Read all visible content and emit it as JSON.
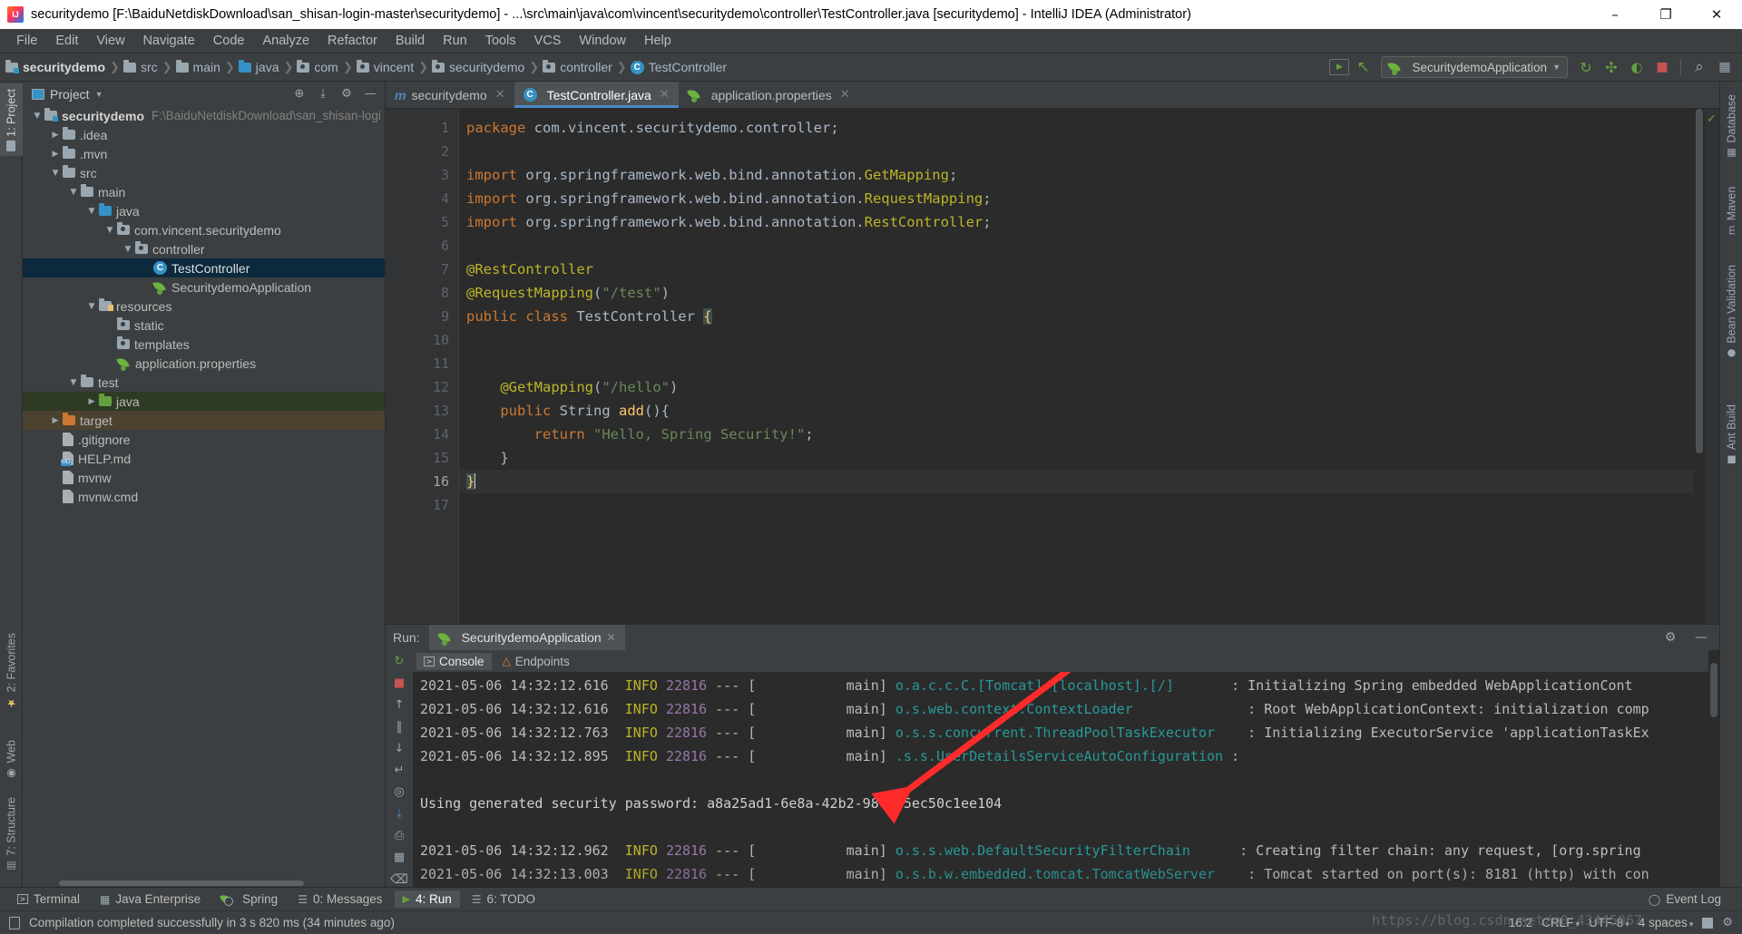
{
  "window": {
    "title": "securitydemo [F:\\BaiduNetdiskDownload\\san_shisan-login-master\\securitydemo] - ...\\src\\main\\java\\com\\vincent\\securitydemo\\controller\\TestController.java [securitydemo] - IntelliJ IDEA (Administrator)",
    "minimize": "–",
    "maximize": "❐",
    "close": "✕"
  },
  "menu": [
    "File",
    "Edit",
    "View",
    "Navigate",
    "Code",
    "Analyze",
    "Refactor",
    "Build",
    "Run",
    "Tools",
    "VCS",
    "Window",
    "Help"
  ],
  "breadcrumb": [
    {
      "label": "securitydemo",
      "icon": "module-icon",
      "bold": true
    },
    {
      "label": "src",
      "icon": "folder-icon",
      "bold": false
    },
    {
      "label": "main",
      "icon": "folder-icon",
      "bold": false
    },
    {
      "label": "java",
      "icon": "source-folder-icon",
      "bold": false
    },
    {
      "label": "com",
      "icon": "package-icon",
      "bold": false
    },
    {
      "label": "vincent",
      "icon": "package-icon",
      "bold": false
    },
    {
      "label": "securitydemo",
      "icon": "package-icon",
      "bold": false
    },
    {
      "label": "controller",
      "icon": "package-icon",
      "bold": false
    },
    {
      "label": "TestController",
      "icon": "class-icon",
      "bold": false
    }
  ],
  "toolbar": {
    "run_config": "SecuritydemoApplication",
    "dropdown_caret": "▼",
    "buttons": [
      {
        "name": "select-run-config-icon",
        "glyph": "▶"
      },
      {
        "name": "hammer-build-icon",
        "glyph": "↖"
      },
      {
        "name": "rerun-icon",
        "glyph": "↻"
      },
      {
        "name": "debug-icon",
        "glyph": "✣"
      },
      {
        "name": "run-with-coverage-icon",
        "glyph": "◐"
      },
      {
        "name": "stop-icon",
        "glyph": "■"
      },
      {
        "name": "search-everywhere-icon",
        "glyph": "⌕"
      },
      {
        "name": "project-structure-icon",
        "glyph": "▦"
      }
    ]
  },
  "left_strip": [
    {
      "label": "1: Project",
      "active": true
    },
    {
      "label": "2: Favorites",
      "active": false
    },
    {
      "label": "Web",
      "active": false
    },
    {
      "label": "7: Structure",
      "active": false
    }
  ],
  "right_strip": [
    {
      "label": "Database"
    },
    {
      "label": "Maven"
    },
    {
      "label": "Bean Validation"
    },
    {
      "label": "Ant Build"
    }
  ],
  "project_panel": {
    "title": "Project",
    "title_caret": "▼",
    "header_buttons": [
      {
        "name": "locate-in-tree-icon",
        "glyph": "⊕"
      },
      {
        "name": "collapse-all-icon",
        "glyph": "⤓"
      },
      {
        "name": "settings-gear-icon",
        "glyph": "⚙"
      },
      {
        "name": "hide-panel-icon",
        "glyph": "—"
      }
    ],
    "tree": [
      {
        "label": "securitydemo",
        "suffix": "F:\\BaiduNetdiskDownload\\san_shisan-logi",
        "indent": 0,
        "arrow": "▼",
        "icon": "module-icon",
        "bold": true,
        "state": ""
      },
      {
        "label": ".idea",
        "suffix": "",
        "indent": 1,
        "arrow": "▶",
        "icon": "folder-icon",
        "bold": false,
        "state": ""
      },
      {
        "label": ".mvn",
        "suffix": "",
        "indent": 1,
        "arrow": "▶",
        "icon": "folder-icon",
        "bold": false,
        "state": ""
      },
      {
        "label": "src",
        "suffix": "",
        "indent": 1,
        "arrow": "▼",
        "icon": "folder-icon",
        "bold": false,
        "state": ""
      },
      {
        "label": "main",
        "suffix": "",
        "indent": 2,
        "arrow": "▼",
        "icon": "folder-icon",
        "bold": false,
        "state": ""
      },
      {
        "label": "java",
        "suffix": "",
        "indent": 3,
        "arrow": "▼",
        "icon": "source-folder-icon",
        "bold": false,
        "state": ""
      },
      {
        "label": "com.vincent.securitydemo",
        "suffix": "",
        "indent": 4,
        "arrow": "▼",
        "icon": "package-icon",
        "bold": false,
        "state": ""
      },
      {
        "label": "controller",
        "suffix": "",
        "indent": 5,
        "arrow": "▼",
        "icon": "package-icon",
        "bold": false,
        "state": ""
      },
      {
        "label": "TestController",
        "suffix": "",
        "indent": 6,
        "arrow": "",
        "icon": "class-icon",
        "bold": false,
        "state": "selected"
      },
      {
        "label": "SecuritydemoApplication",
        "suffix": "",
        "indent": 6,
        "arrow": "",
        "icon": "spring-class-icon",
        "bold": false,
        "state": ""
      },
      {
        "label": "resources",
        "suffix": "",
        "indent": 3,
        "arrow": "▼",
        "icon": "resources-folder-icon",
        "bold": false,
        "state": ""
      },
      {
        "label": "static",
        "suffix": "",
        "indent": 4,
        "arrow": "",
        "icon": "package-icon",
        "bold": false,
        "state": ""
      },
      {
        "label": "templates",
        "suffix": "",
        "indent": 4,
        "arrow": "",
        "icon": "package-icon",
        "bold": false,
        "state": ""
      },
      {
        "label": "application.properties",
        "suffix": "",
        "indent": 4,
        "arrow": "",
        "icon": "spring-file-icon",
        "bold": false,
        "state": ""
      },
      {
        "label": "test",
        "suffix": "",
        "indent": 2,
        "arrow": "▼",
        "icon": "folder-icon",
        "bold": false,
        "state": ""
      },
      {
        "label": "java",
        "suffix": "",
        "indent": 3,
        "arrow": "▶",
        "icon": "test-source-folder-icon",
        "bold": false,
        "state": "green"
      },
      {
        "label": "target",
        "suffix": "",
        "indent": 1,
        "arrow": "▶",
        "icon": "excluded-folder-icon",
        "bold": false,
        "state": "brown"
      },
      {
        "label": ".gitignore",
        "suffix": "",
        "indent": 2,
        "arrow": "",
        "icon": "file-icon",
        "bold": false,
        "state": ""
      },
      {
        "label": "HELP.md",
        "suffix": "",
        "indent": 2,
        "arrow": "",
        "icon": "markdown-file-icon",
        "bold": false,
        "state": ""
      },
      {
        "label": "mvnw",
        "suffix": "",
        "indent": 2,
        "arrow": "",
        "icon": "file-icon",
        "bold": false,
        "state": ""
      },
      {
        "label": "mvnw.cmd",
        "suffix": "",
        "indent": 2,
        "arrow": "",
        "icon": "file-icon",
        "bold": false,
        "state": ""
      }
    ]
  },
  "editor": {
    "tabs": [
      {
        "label": "securitydemo",
        "icon": "maven-icon",
        "active": false,
        "close": "✕"
      },
      {
        "label": "TestController.java",
        "icon": "class-icon",
        "active": true,
        "close": "✕"
      },
      {
        "label": "application.properties",
        "icon": "spring-file-icon",
        "active": false,
        "close": "✕"
      }
    ],
    "inspection_status": "✓",
    "caret_position": "16:2",
    "lines": [
      {
        "n": 1,
        "text": "package com.vincent.securitydemo.controller;"
      },
      {
        "n": 2,
        "text": ""
      },
      {
        "n": 3,
        "text": "import org.springframework.web.bind.annotation.GetMapping;"
      },
      {
        "n": 4,
        "text": "import org.springframework.web.bind.annotation.RequestMapping;"
      },
      {
        "n": 5,
        "text": "import org.springframework.web.bind.annotation.RestController;"
      },
      {
        "n": 6,
        "text": ""
      },
      {
        "n": 7,
        "text": "@RestController"
      },
      {
        "n": 8,
        "text": "@RequestMapping(\"/test\")"
      },
      {
        "n": 9,
        "text": "public class TestController {"
      },
      {
        "n": 10,
        "text": ""
      },
      {
        "n": 11,
        "text": ""
      },
      {
        "n": 12,
        "text": "    @GetMapping(\"/hello\")"
      },
      {
        "n": 13,
        "text": "    public String add(){"
      },
      {
        "n": 14,
        "text": "        return \"Hello, Spring Security!\";"
      },
      {
        "n": 15,
        "text": "    }"
      },
      {
        "n": 16,
        "text": "}"
      },
      {
        "n": 17,
        "text": ""
      }
    ]
  },
  "run_panel": {
    "label": "Run:",
    "tab": "SecuritydemoApplication",
    "tab_close": "✕",
    "settings_icon": "⚙",
    "hide_icon": "—",
    "console_tabs": [
      {
        "label": "Console",
        "active": true,
        "icon": "console-icon"
      },
      {
        "label": "Endpoints",
        "active": false,
        "icon": "endpoints-icon"
      }
    ],
    "side_buttons": [
      {
        "name": "rerun-icon",
        "glyph": "↻"
      },
      {
        "name": "stop-icon",
        "glyph": "■"
      },
      {
        "name": "scroll-up-icon",
        "glyph": "↑"
      },
      {
        "name": "pause-icon",
        "glyph": "‖"
      },
      {
        "name": "scroll-down-icon",
        "glyph": "↓"
      },
      {
        "name": "soft-wrap-icon",
        "glyph": "↵"
      },
      {
        "name": "camera-icon",
        "glyph": "◎"
      },
      {
        "name": "scroll-to-end-icon",
        "glyph": "⤓"
      },
      {
        "name": "print-icon",
        "glyph": "⎙"
      },
      {
        "name": "dump-threads-icon",
        "glyph": "▦"
      },
      {
        "name": "clear-all-icon",
        "glyph": "Ὕ1"
      }
    ],
    "log_lines": [
      {
        "ts": "2021-05-06 14:32:12.616",
        "level": "INFO",
        "pid": "22816",
        "dash": "---",
        "thread": "main]",
        "logger": "o.a.c.c.C.[Tomcat].[localhost].[/]",
        "msg": ": Initializing Spring embedded WebApplicationCont",
        "type": "log"
      },
      {
        "ts": "2021-05-06 14:32:12.616",
        "level": "INFO",
        "pid": "22816",
        "dash": "---",
        "thread": "main]",
        "logger": "o.s.web.context.ContextLoader",
        "msg": ": Root WebApplicationContext: initialization comp",
        "type": "log"
      },
      {
        "ts": "2021-05-06 14:32:12.763",
        "level": "INFO",
        "pid": "22816",
        "dash": "---",
        "thread": "main]",
        "logger": "o.s.s.concurrent.ThreadPoolTaskExecutor",
        "msg": ": Initializing ExecutorService 'applicationTaskEx",
        "type": "log"
      },
      {
        "ts": "2021-05-06 14:32:12.895",
        "level": "INFO",
        "pid": "22816",
        "dash": "---",
        "thread": "main]",
        "logger": ".s.s.UserDetailsServiceAutoConfiguration",
        "msg": ":",
        "type": "log"
      },
      {
        "text": "",
        "type": "blank"
      },
      {
        "text": "Using generated security password: a8a25ad1-6e8a-42b2-98c3-5ec50c1ee104",
        "type": "plain"
      },
      {
        "text": "",
        "type": "blank"
      },
      {
        "ts": "2021-05-06 14:32:12.962",
        "level": "INFO",
        "pid": "22816",
        "dash": "---",
        "thread": "main]",
        "logger": "o.s.s.web.DefaultSecurityFilterChain",
        "msg": ": Creating filter chain: any request, [org.spring",
        "type": "log"
      },
      {
        "ts": "2021-05-06 14:32:13.003",
        "level": "INFO",
        "pid": "22816",
        "dash": "---",
        "thread": "main]",
        "logger": "o.s.b.w.embedded.tomcat.TomcatWebServer",
        "msg": ": Tomcat started on port(s): 8181 (http) with con",
        "type": "log"
      }
    ]
  },
  "bottom_tabs": [
    {
      "label": "Terminal",
      "active": false,
      "icon": "terminal-icon"
    },
    {
      "label": "Java Enterprise",
      "active": false,
      "icon": "java-enterprise-icon"
    },
    {
      "label": "Spring",
      "active": false,
      "icon": "spring-icon"
    },
    {
      "label": "0: Messages",
      "active": false,
      "icon": "messages-icon"
    },
    {
      "label": "4: Run",
      "active": true,
      "icon": "run-icon"
    },
    {
      "label": "6: TODO",
      "active": false,
      "icon": "todo-icon"
    }
  ],
  "event_log": "Event Log",
  "statusbar": {
    "message": "Compilation completed successfully in 3 s 820 ms (34 minutes ago)",
    "caret": "16:2",
    "line_separator": "CRLF",
    "encoding": "UTF-8",
    "indent": "4 spaces",
    "caret_glyph": "▾",
    "watermark": "https://blog.csdn.net/m0_43445067"
  },
  "colors": {
    "accent_blue": "#3592c4",
    "selection_blue": "#0d293e",
    "spring_green": "#6db33f",
    "orange_keyword": "#cc7832",
    "string_green": "#6a8759",
    "annotation_yellow": "#bbb529",
    "method_yellow": "#ffc66d",
    "logger_teal": "#299999",
    "pid_purple": "#9876aa",
    "arrow_red": "#ff2a2a"
  }
}
